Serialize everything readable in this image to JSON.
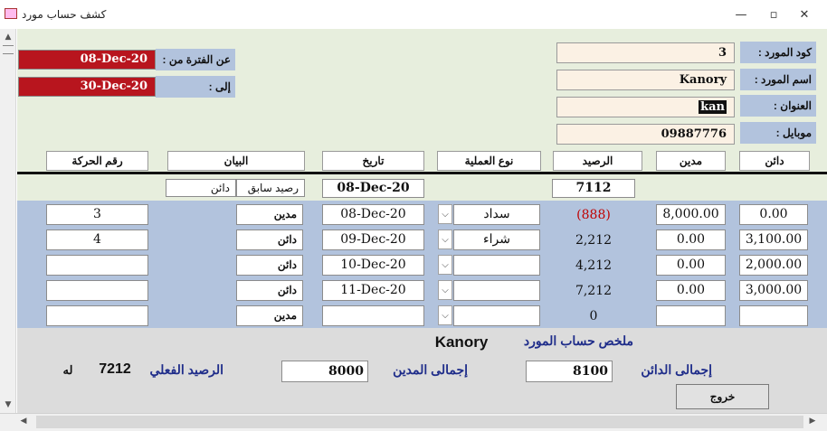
{
  "window": {
    "title": "كشف حساب مورد",
    "minimize": "—",
    "restore": "▫",
    "close": "✕"
  },
  "supplier": {
    "code_label": "كود المورد :",
    "code": "3",
    "name_label": "اسم المورد :",
    "name": "Kanory",
    "address_label": "العنوان :",
    "address": "kan",
    "mobile_label": "موبايل :",
    "mobile": "09887776"
  },
  "period": {
    "from_label": "عن الفترة من :",
    "from": "08-Dec-20",
    "to_label": "إلى :",
    "to": "30-Dec-20"
  },
  "headers": {
    "creditor": "دائن",
    "debtor": "مدين",
    "balance": "الرصيد",
    "op_type": "نوع العملية",
    "date": "تاريخ",
    "statement": "البيان",
    "movement_no": "رقم الحركة"
  },
  "previous": {
    "type": "دائن",
    "label": "رصيد سابق",
    "date": "08-Dec-20",
    "balance": "7112"
  },
  "rows": [
    {
      "creditor": "0.00",
      "debtor": "8,000.00",
      "balance": "(888)",
      "op_type": "سداد",
      "date": "08-Dec-20",
      "statement": "مدين",
      "movement_no": "3"
    },
    {
      "creditor": "3,100.00",
      "debtor": "0.00",
      "balance": "2,212",
      "op_type": "شراء",
      "date": "09-Dec-20",
      "statement": "دائن",
      "movement_no": "4"
    },
    {
      "creditor": "2,000.00",
      "debtor": "0.00",
      "balance": "4,212",
      "op_type": "",
      "date": "10-Dec-20",
      "statement": "دائن",
      "movement_no": ""
    },
    {
      "creditor": "3,000.00",
      "debtor": "0.00",
      "balance": "7,212",
      "op_type": "",
      "date": "11-Dec-20",
      "statement": "دائن",
      "movement_no": ""
    },
    {
      "creditor": "",
      "debtor": "",
      "balance": "0",
      "op_type": "",
      "date": "",
      "statement": "مدين",
      "movement_no": ""
    }
  ],
  "summary": {
    "title": "ملخص  حساب المورد",
    "supplier_name": "Kanory",
    "total_creditor_label": "إجمالى الدائن",
    "total_creditor": "8100",
    "total_debtor_label": "إجمالى المدين",
    "total_debtor": "8000",
    "actual_balance_label": "الرصيد الفعلي",
    "actual_balance": "7212",
    "balance_side": "له",
    "exit_label": "خروج"
  },
  "colors": {
    "red_field": "#b8151e",
    "negative": "#c00000",
    "navy": "#1f2d8a",
    "row_bg": "#b2c3dd",
    "form_bg": "#e7eedd"
  }
}
